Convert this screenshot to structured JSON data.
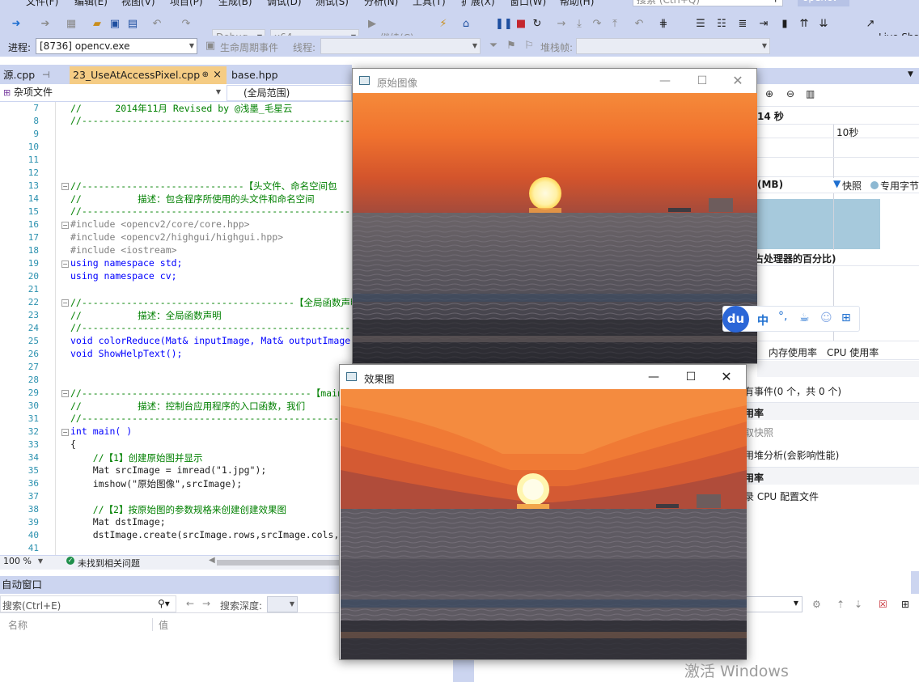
{
  "menubar": {
    "items": [
      "文件(F)",
      "编辑(E)",
      "视图(V)",
      "项目(P)",
      "生成(B)",
      "调试(D)",
      "测试(S)",
      "分析(N)",
      "工具(T)",
      "扩展(X)",
      "窗口(W)",
      "帮助(H)"
    ],
    "search_placeholder": "搜索 (Ctrl+Q)",
    "solution_name": "opencv"
  },
  "toolbar": {
    "config": "Debug",
    "platform": "x64",
    "continue_label": "继续(C)",
    "live_share": "Live Share",
    "process_label": "进程:",
    "process_value": "[8736] opencv.exe",
    "lifecycle_label": "生命周期事件",
    "thread_label": "线程:",
    "stackframe_label": "堆栈帧:"
  },
  "tabs": {
    "partial": "源.cpp",
    "active": "23_UseAtAccessPixel.cpp",
    "active_pin": "⊕",
    "active_close": "×",
    "other": "base.hpp"
  },
  "nav": {
    "project": "杂项文件",
    "scope": "(全局范围)"
  },
  "editor": {
    "lines": [
      {
        "n": "7",
        "text": "//      2014年11月 Revised by @浅墨_毛星云",
        "cls": "cm"
      },
      {
        "n": "8",
        "text": "//----------------------------------------------------",
        "cls": "cm"
      },
      {
        "n": "9",
        "text": "",
        "cls": ""
      },
      {
        "n": "10",
        "text": "",
        "cls": ""
      },
      {
        "n": "11",
        "text": "",
        "cls": ""
      },
      {
        "n": "12",
        "text": "",
        "cls": ""
      },
      {
        "n": "13",
        "text": "//-----------------------------【头文件、命名空间包",
        "cls": "cm"
      },
      {
        "n": "14",
        "text": "//          描述：包含程序所使用的头文件和命名空间",
        "cls": "cm"
      },
      {
        "n": "15",
        "text": "//----------------------------------------------------",
        "cls": "cm"
      },
      {
        "n": "16",
        "text": "#include <opencv2/core/core.hpp>",
        "cls": "pp"
      },
      {
        "n": "17",
        "text": "#include <opencv2/highgui/highgui.hpp>",
        "cls": "pp"
      },
      {
        "n": "18",
        "text": "#include <iostream>",
        "cls": "pp"
      },
      {
        "n": "19",
        "text": "using namespace std;",
        "cls": "kw"
      },
      {
        "n": "20",
        "text": "using namespace cv;",
        "cls": "kw"
      },
      {
        "n": "21",
        "text": "",
        "cls": ""
      },
      {
        "n": "22",
        "text": "//--------------------------------------【全局函数声明",
        "cls": "cm"
      },
      {
        "n": "23",
        "text": "//          描述：全局函数声明",
        "cls": "cm"
      },
      {
        "n": "24",
        "text": "//----------------------------------------------------",
        "cls": "cm"
      },
      {
        "n": "25",
        "text": "void colorReduce(Mat& inputImage, Mat& outputImage",
        "cls": "kw"
      },
      {
        "n": "26",
        "text": "void ShowHelpText();",
        "cls": "kw"
      },
      {
        "n": "27",
        "text": "",
        "cls": ""
      },
      {
        "n": "28",
        "text": "",
        "cls": ""
      },
      {
        "n": "29",
        "text": "//-----------------------------------------【main( )",
        "cls": "cm"
      },
      {
        "n": "30",
        "text": "//          描述：控制台应用程序的入口函数，我们",
        "cls": "cm"
      },
      {
        "n": "31",
        "text": "//----------------------------------------------------",
        "cls": "cm"
      },
      {
        "n": "32",
        "text": "int main( )",
        "cls": "kw"
      },
      {
        "n": "33",
        "text": "{",
        "cls": ""
      },
      {
        "n": "34",
        "text": "    //【1】创建原始图并显示",
        "cls": "cm"
      },
      {
        "n": "35",
        "text": "    Mat srcImage = imread(\"1.jpg\");",
        "cls": ""
      },
      {
        "n": "36",
        "text": "    imshow(\"原始图像\",srcImage);",
        "cls": ""
      },
      {
        "n": "37",
        "text": "",
        "cls": ""
      },
      {
        "n": "38",
        "text": "    //【2】按原始图的参数规格来创建创建效果图",
        "cls": "cm"
      },
      {
        "n": "39",
        "text": "    Mat dstImage;",
        "cls": ""
      },
      {
        "n": "40",
        "text": "    dstImage.create(srcImage.rows,srcImage.cols,",
        "cls": ""
      },
      {
        "n": "41",
        "text": "",
        "cls": ""
      }
    ]
  },
  "status": {
    "zoom": "100 %",
    "issues": "未找到相关问题"
  },
  "autos": {
    "title": "自动窗口",
    "search_placeholder": "搜索(Ctrl+E)",
    "search_depth_label": "搜索深度:",
    "col_name": "名称",
    "col_value": "值"
  },
  "diag": {
    "time_label": "14 秒",
    "tick_10s": "10秒",
    "memory_label": "(MB)",
    "snapshot_legend": "快照",
    "private_legend": "专用字节",
    "cpu_title": "占处理器的百分比)",
    "tab_memory": "内存使用率",
    "tab_cpu": "CPU 使用率",
    "events_text": "有事件(0 个，共 0 个)",
    "section1": "用率",
    "snapshot_action": "取快照",
    "heap_action": "用堆分析(会影响性能)",
    "section2": "用率",
    "cpu_profile_action": "录 CPU 配置文件"
  },
  "window_original": {
    "title": "原始图像"
  },
  "window_effect": {
    "title": "效果图"
  },
  "ime": {
    "logo": "du",
    "mode": "中"
  },
  "watermark": "激活 Windows"
}
